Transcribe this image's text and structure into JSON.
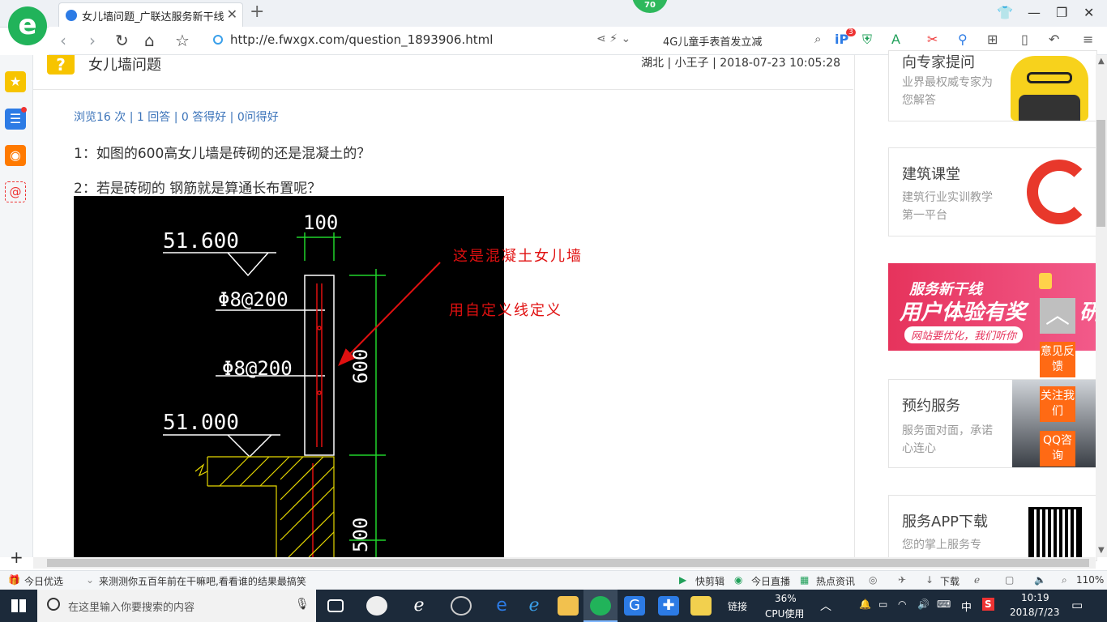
{
  "browser": {
    "tab_title": "女儿墙问题_广联达服务新干线",
    "update_badge": "70",
    "url": "http://e.fwxgx.com/question_1893906.html",
    "search_text": "4G儿童手表首发立减",
    "ext_badge": "3"
  },
  "question": {
    "title": "女儿墙问题",
    "meta": "湖北 | 小王子 | 2018-07-23 10:05:28",
    "stats": "浏览16 次 | 1 回答 | 0 答得好 | 0问得好",
    "line1": "1：如图的600高女儿墙是砖砌的还是混凝土的？",
    "line2": "2：若是砖砌的 钢筋就是算通长布置呢？"
  },
  "cad": {
    "elev_top": "51.600",
    "elev_bottom": "51.000",
    "dim_width": "100",
    "rebar_1": "Φ8@200",
    "rebar_2": "Φ8@200",
    "dim_600": "600",
    "dim_500": "500",
    "annotation_1": "这是混凝土女儿墙",
    "annotation_2": "用自定义线定义"
  },
  "right": {
    "expert_title": "向专家提问",
    "expert_sub": "业界最权威专家为您解答",
    "class_title": "建筑课堂",
    "class_sub": "建筑行业实训教学第一平台",
    "banner_line1": "服务新干线",
    "banner_line2": "用户体验有奖",
    "banner_line2_tail": "研",
    "banner_line3": "网站要优化，我们听你",
    "booking_title": "预约服务",
    "booking_sub": "服务面对面，承诺心连心",
    "app_title": "服务APP下载",
    "app_sub": "您的掌上服务专",
    "feedback": "意见反馈",
    "follow": "关注我们",
    "qq": "QQ咨询"
  },
  "statusbar": {
    "left1": "今日优选",
    "left2": "来测测你五百年前在干嘛吧,看看谁的结果最搞笑",
    "quick_cut": "快剪辑",
    "live": "今日直播",
    "news": "热点资讯",
    "download": "下载",
    "zoom": "110%"
  },
  "taskbar": {
    "search_placeholder": "在这里输入你要搜索的内容",
    "links": "链接",
    "cpu_percent": "36%",
    "cpu_label": "CPU使用",
    "ime": "中",
    "time": "10:19",
    "date": "2018/7/23"
  },
  "colors": {
    "accent_green": "#21b35a",
    "link_blue": "#3b73b9",
    "cad_red": "#e01010",
    "orange": "#ff6a14"
  }
}
